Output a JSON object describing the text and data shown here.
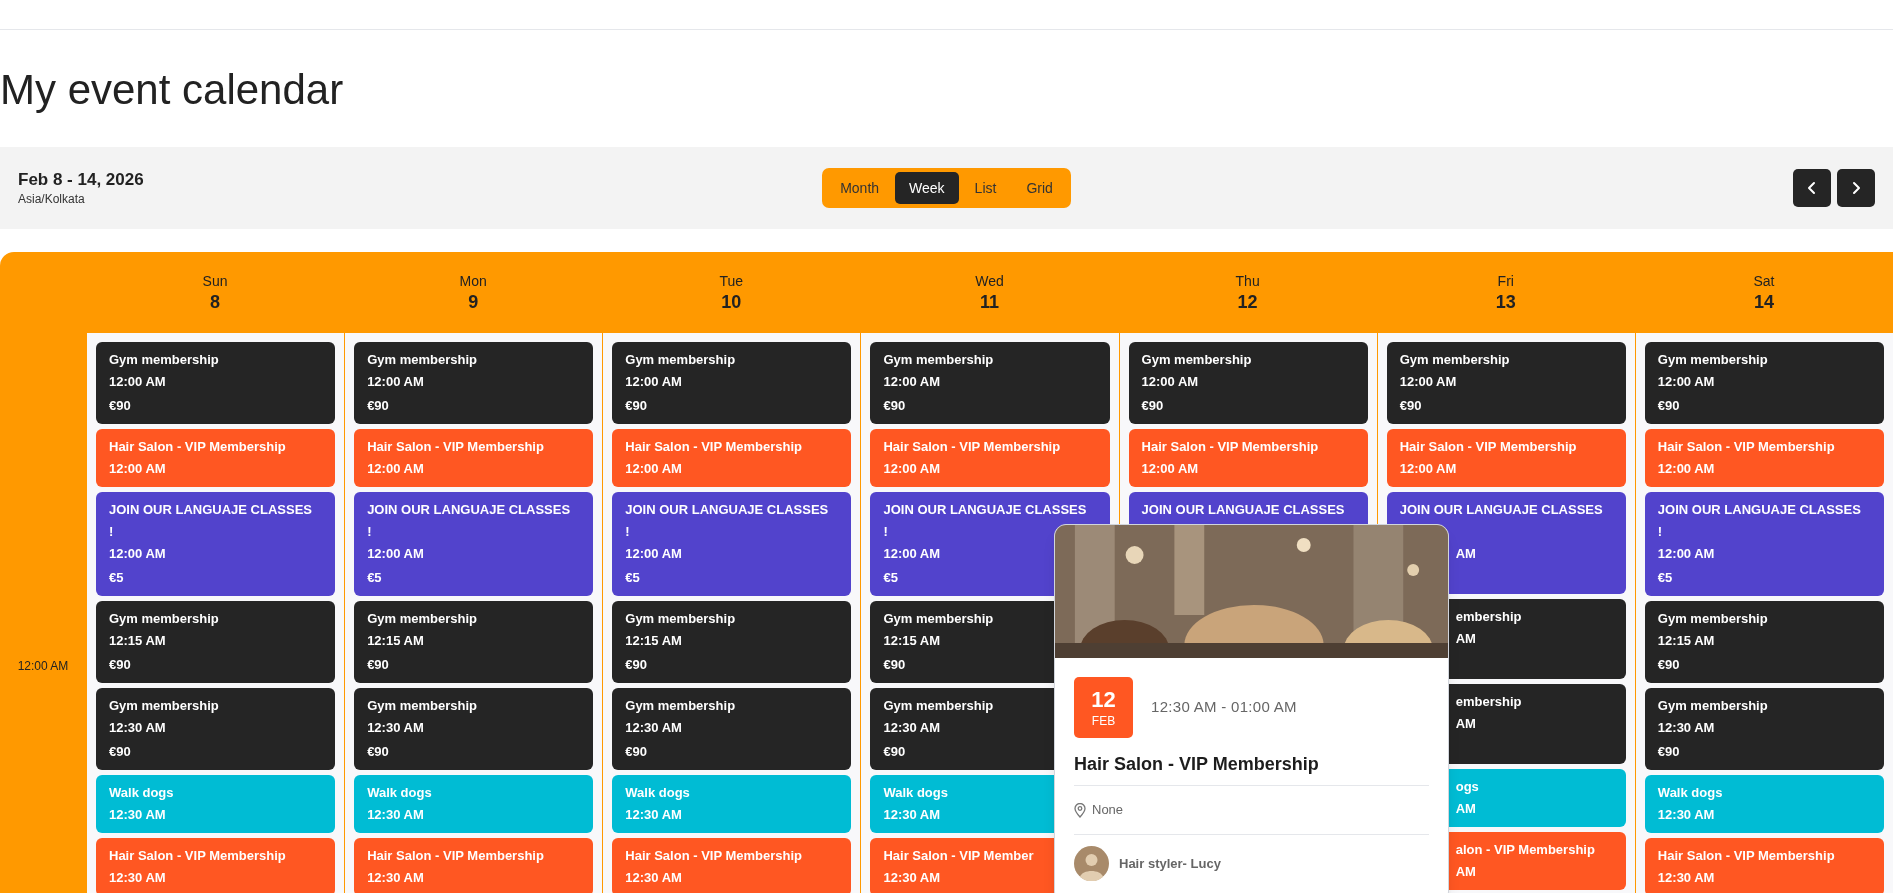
{
  "page": {
    "title": "My event calendar"
  },
  "toolbar": {
    "date_range": "Feb 8 - 14, 2026",
    "timezone": "Asia/Kolkata",
    "views": [
      {
        "label": "Month",
        "selected": false
      },
      {
        "label": "Week",
        "selected": true
      },
      {
        "label": "List",
        "selected": false
      },
      {
        "label": "Grid",
        "selected": false
      }
    ]
  },
  "calendar": {
    "time_slots": [
      "12:00 AM"
    ],
    "days": [
      {
        "weekday": "Sun",
        "date": "8",
        "events": [
          {
            "kind": "full",
            "color": "#252525",
            "title": "Gym membership",
            "time": "12:00 AM",
            "price": "€90"
          },
          {
            "kind": "full",
            "color": "#ff5722",
            "title": "Hair Salon - VIP Membership",
            "time": "12:00 AM"
          },
          {
            "kind": "full",
            "color": "#5243cc",
            "title": "JOIN OUR LANGUAJE CLASSES !",
            "time": "12:00 AM",
            "price": "€5"
          },
          {
            "kind": "full",
            "color": "#252525",
            "title": "Gym membership",
            "time": "12:15 AM",
            "price": "€90"
          },
          {
            "kind": "full",
            "color": "#252525",
            "title": "Gym membership",
            "time": "12:30 AM",
            "price": "€90"
          },
          {
            "kind": "full",
            "color": "#00bcd4",
            "title": "Walk dogs",
            "time": "12:30 AM"
          },
          {
            "kind": "full",
            "color": "#ff5722",
            "title": "Hair Salon - VIP Membership",
            "time": "12:30 AM"
          }
        ]
      },
      {
        "weekday": "Mon",
        "date": "9",
        "events": [
          {
            "kind": "full",
            "color": "#252525",
            "title": "Gym membership",
            "time": "12:00 AM",
            "price": "€90"
          },
          {
            "kind": "full",
            "color": "#ff5722",
            "title": "Hair Salon - VIP Membership",
            "time": "12:00 AM"
          },
          {
            "kind": "full",
            "color": "#5243cc",
            "title": "JOIN OUR LANGUAJE CLASSES !",
            "time": "12:00 AM",
            "price": "€5"
          },
          {
            "kind": "full",
            "color": "#252525",
            "title": "Gym membership",
            "time": "12:15 AM",
            "price": "€90"
          },
          {
            "kind": "full",
            "color": "#252525",
            "title": "Gym membership",
            "time": "12:30 AM",
            "price": "€90"
          },
          {
            "kind": "full",
            "color": "#00bcd4",
            "title": "Walk dogs",
            "time": "12:30 AM"
          },
          {
            "kind": "full",
            "color": "#ff5722",
            "title": "Hair Salon - VIP Membership",
            "time": "12:30 AM"
          }
        ]
      },
      {
        "weekday": "Tue",
        "date": "10",
        "events": [
          {
            "kind": "full",
            "color": "#252525",
            "title": "Gym membership",
            "time": "12:00 AM",
            "price": "€90"
          },
          {
            "kind": "full",
            "color": "#ff5722",
            "title": "Hair Salon - VIP Membership",
            "time": "12:00 AM"
          },
          {
            "kind": "full",
            "color": "#5243cc",
            "title": "JOIN OUR LANGUAJE CLASSES !",
            "time": "12:00 AM",
            "price": "€5"
          },
          {
            "kind": "full",
            "color": "#252525",
            "title": "Gym membership",
            "time": "12:15 AM",
            "price": "€90"
          },
          {
            "kind": "full",
            "color": "#252525",
            "title": "Gym membership",
            "time": "12:30 AM",
            "price": "€90"
          },
          {
            "kind": "full",
            "color": "#00bcd4",
            "title": "Walk dogs",
            "time": "12:30 AM"
          },
          {
            "kind": "full",
            "color": "#ff5722",
            "title": "Hair Salon - VIP Membership",
            "time": "12:30 AM"
          }
        ]
      },
      {
        "weekday": "Wed",
        "date": "11",
        "events": [
          {
            "kind": "full",
            "color": "#252525",
            "title": "Gym membership",
            "time": "12:00 AM",
            "price": "€90"
          },
          {
            "kind": "full",
            "color": "#ff5722",
            "title": "Hair Salon - VIP Membership",
            "time": "12:00 AM"
          },
          {
            "kind": "full",
            "color": "#5243cc",
            "title": "JOIN OUR LANGUAJE CLASSES !",
            "time": "12:00 AM",
            "price": "€5"
          },
          {
            "kind": "full",
            "color": "#252525",
            "title": "Gym membership",
            "time": "12:15 AM",
            "price": "€90"
          },
          {
            "kind": "full",
            "color": "#252525",
            "title": "Gym membership",
            "time": "12:30 AM",
            "price": "€90"
          },
          {
            "kind": "full",
            "color": "#00bcd4",
            "title": "Walk dogs",
            "time": "12:30 AM"
          },
          {
            "kind": "full",
            "color": "#ff5722",
            "title": "Hair Salon - VIP Member",
            "time": "12:30 AM"
          }
        ]
      },
      {
        "weekday": "Thu",
        "date": "12",
        "events": [
          {
            "kind": "full",
            "color": "#252525",
            "title": "Gym membership",
            "time": "12:00 AM",
            "price": "€90"
          },
          {
            "kind": "full",
            "color": "#ff5722",
            "title": "Hair Salon - VIP Membership",
            "time": "12:00 AM"
          },
          {
            "kind": "clipped",
            "color": "#5243cc",
            "rows": [
              {
                "kind": "title",
                "text": "JOIN OUR LANGUAJE CLASSES",
                "indent": false
              },
              {
                "kind": "blank"
              },
              {
                "kind": "blank"
              },
              {
                "kind": "blank"
              }
            ]
          }
        ]
      },
      {
        "weekday": "Fri",
        "date": "13",
        "events": [
          {
            "kind": "full",
            "color": "#252525",
            "title": "Gym membership",
            "time": "12:00 AM",
            "price": "€90"
          },
          {
            "kind": "full",
            "color": "#ff5722",
            "title": "Hair Salon - VIP Membership",
            "time": "12:00 AM"
          },
          {
            "kind": "clipped",
            "color": "#5243cc",
            "rows": [
              {
                "kind": "title",
                "text": "JOIN OUR LANGUAJE CLASSES",
                "indent": false
              },
              {
                "kind": "blank"
              },
              {
                "kind": "time",
                "text": "AM",
                "indent": true
              },
              {
                "kind": "blank"
              }
            ]
          },
          {
            "kind": "clipped",
            "color": "#252525",
            "rows": [
              {
                "kind": "title",
                "text": "embership",
                "indent": true
              },
              {
                "kind": "time",
                "text": "AM",
                "indent": true
              },
              {
                "kind": "blank"
              }
            ]
          },
          {
            "kind": "clipped",
            "color": "#252525",
            "rows": [
              {
                "kind": "title",
                "text": "embership",
                "indent": true
              },
              {
                "kind": "time",
                "text": "AM",
                "indent": true
              },
              {
                "kind": "blank"
              }
            ]
          },
          {
            "kind": "clipped",
            "color": "#00bcd4",
            "rows": [
              {
                "kind": "title",
                "text": "ogs",
                "indent": true
              },
              {
                "kind": "time",
                "text": "AM",
                "indent": true
              }
            ]
          },
          {
            "kind": "clipped",
            "color": "#ff5722",
            "rows": [
              {
                "kind": "title",
                "text": "alon - VIP Membership",
                "indent": true
              },
              {
                "kind": "time",
                "text": "AM",
                "indent": true
              }
            ]
          }
        ]
      },
      {
        "weekday": "Sat",
        "date": "14",
        "events": [
          {
            "kind": "full",
            "color": "#252525",
            "title": "Gym membership",
            "time": "12:00 AM",
            "price": "€90"
          },
          {
            "kind": "full",
            "color": "#ff5722",
            "title": "Hair Salon - VIP Membership",
            "time": "12:00 AM"
          },
          {
            "kind": "full",
            "color": "#5243cc",
            "title": "JOIN OUR LANGUAJE CLASSES !",
            "time": "12:00 AM",
            "price": "€5"
          },
          {
            "kind": "full",
            "color": "#252525",
            "title": "Gym membership",
            "time": "12:15 AM",
            "price": "€90"
          },
          {
            "kind": "full",
            "color": "#252525",
            "title": "Gym membership",
            "time": "12:30 AM",
            "price": "€90"
          },
          {
            "kind": "full",
            "color": "#00bcd4",
            "title": "Walk dogs",
            "time": "12:30 AM"
          },
          {
            "kind": "full",
            "color": "#ff5722",
            "title": "Hair Salon - VIP Membership",
            "time": "12:30 AM"
          }
        ]
      }
    ]
  },
  "popup": {
    "kind": "picture",
    "day": "12",
    "month": "FEB",
    "time": "12:30 AM - 01:00 AM",
    "title": "Hair Salon - VIP Membership",
    "location": "None",
    "host": "Hair styler- Lucy"
  }
}
